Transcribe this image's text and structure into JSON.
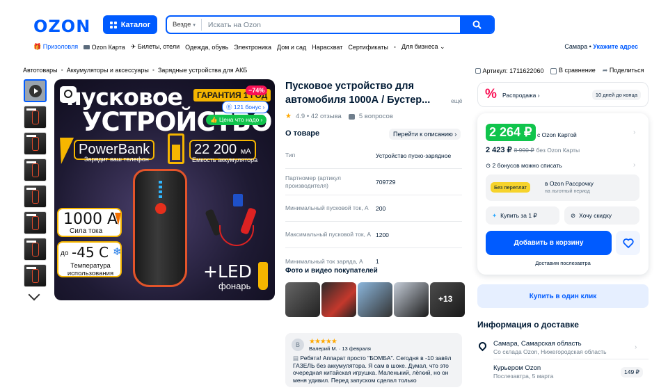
{
  "header": {
    "logo": "OZON",
    "catalog_label": "Каталог",
    "search_scope": "Везде",
    "search_placeholder": "Искать на Ozon"
  },
  "topnav": {
    "items": [
      "Призоловля",
      "Ozon Карта",
      "Билеты, отели",
      "Одежда, обувь",
      "Электроника",
      "Дом и сад",
      "Нарасхват",
      "Сертификаты",
      "Для бизнеса"
    ],
    "region_city": "Самара •",
    "region_link": "Укажите адрес"
  },
  "breadcrumbs": [
    "Автотовары",
    "Аккумуляторы и аксессуары",
    "Зарядные устройства для АКБ"
  ],
  "article": {
    "sku": "Артикул: 1711622060",
    "compare": "В сравнение",
    "share": "Поделиться"
  },
  "gallery": {
    "banner_line1": "пусковое",
    "banner_line2": "УСТРОЙСТВО",
    "guarantee": "ГАРАНТИЯ 1 ГОД",
    "discount": "−74%",
    "bonus": "121 бонус",
    "fair_price": "Цена что надо",
    "powerbank": "PowerBank",
    "powerbank_sub": "Зарядит ваш телефон",
    "capacity": "22 200",
    "capacity_unit": "мА",
    "capacity_sub": "Емкость аккумулятора",
    "amp_value": "1000 А",
    "amp_sub": "Сила тока",
    "temp_prefix": "до",
    "temp_value": "-45 С",
    "temp_sub": "Температура использования",
    "led": "+LED",
    "led_sub": "фонарь"
  },
  "product": {
    "title": "Пусковое устройство для автомобиля 1000А / Бустер...",
    "more": "ещё",
    "rating": "4.9 • 42 отзыва",
    "questions": "5 вопросов",
    "about_title": "О товаре",
    "desc_link": "Перейти к описанию",
    "specs": [
      {
        "k": "Тип",
        "v": "Устройство пуско-зарядное"
      },
      {
        "k": "Партномер (артикул производителя)",
        "v": "709729"
      },
      {
        "k": "Минимальный пусковой ток, А",
        "v": "200"
      },
      {
        "k": "Максимальный пусковой ток, А",
        "v": "1200"
      },
      {
        "k": "Минимальный ток заряда, А",
        "v": "1"
      }
    ],
    "photos_title": "Фото и видео покупателей",
    "photos_more": "+13"
  },
  "review": {
    "avatar": "В",
    "stars": "★★★★★",
    "author_date": "Валерий М. · 13 февраля",
    "text": "Ребята! Аппарат просто \"БОМБА\". Сегодня в -10 завёл ГАЗЕЛЬ без аккумулятора. Я сам в шоке. Думал, что это очередная китайская игрушка. Маленький, лёгкий, но он меня удивил. Перед запуском сделал только"
  },
  "buybox": {
    "sale_label": "Распродажа",
    "sale_days": "10 дней до конца",
    "price_card": "2 264 ₽",
    "price_card_note": "с Ozon Картой",
    "price_regular": "2 423 ₽",
    "price_old": "8 990 ₽",
    "price_regular_note": "без Ozon Карты",
    "bonuses": "2 бонусов можно списать",
    "install_tag": "Без переплат",
    "install_title": "в Ozon Рассрочку",
    "install_sub": "на льготный период",
    "buy_for": "Купить за 1 ₽",
    "want_discount": "Хочу скидку",
    "add_to_cart": "Добавить в корзину",
    "delivery_date": "Доставим послезавтра",
    "one_click": "Купить в один клик"
  },
  "delivery": {
    "title": "Информация о доставке",
    "city": "Самара, Самарская область",
    "warehouse": "Со склада Ozon, Нижегородская область",
    "courier": "Курьером Ozon",
    "courier_date": "Послезавтра, 5 марта",
    "courier_price": "149 ₽"
  },
  "colors": {
    "brand": "#005bff",
    "green_price": "#10c44c",
    "sale_pink": "#f91155",
    "gold": "#f6b600"
  }
}
